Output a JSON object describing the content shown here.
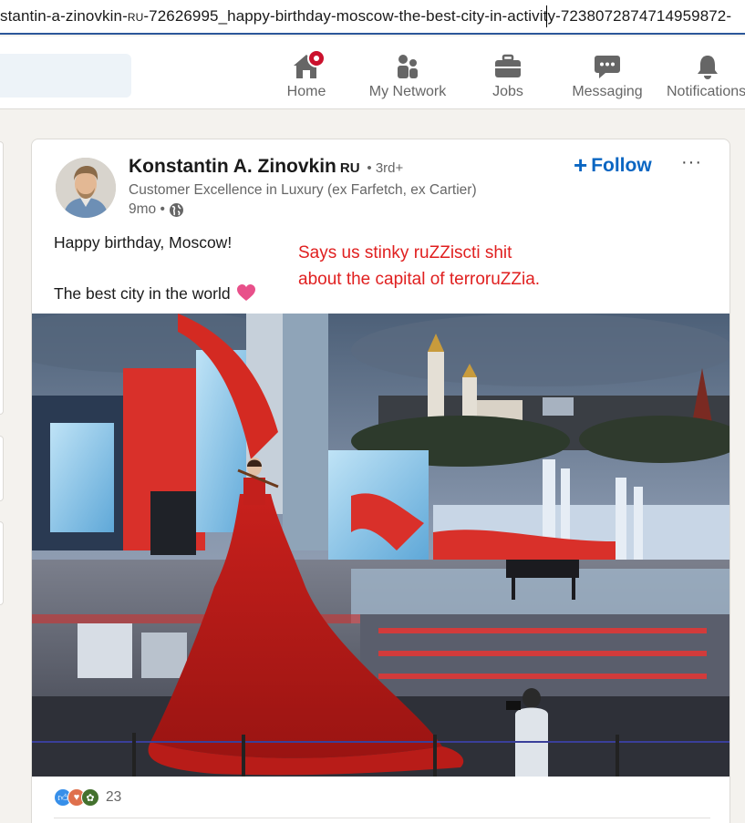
{
  "browser": {
    "url_prefix": "stantin-a-zinovkin-",
    "url_ru": "RU",
    "url_suffix": "-72626995_happy-birthday-moscow-the-best-city-in-activity-7238072874714959872-"
  },
  "nav": {
    "items": [
      {
        "label": "Home",
        "icon": "home-icon"
      },
      {
        "label": "My Network",
        "icon": "network-icon"
      },
      {
        "label": "Jobs",
        "icon": "jobs-icon"
      },
      {
        "label": "Messaging",
        "icon": "messaging-icon"
      },
      {
        "label": "Notifications",
        "icon": "bell-icon"
      }
    ]
  },
  "post": {
    "author": "Konstantin A. Zinovkin",
    "author_tag": "RU",
    "degree": "• 3rd+",
    "headline": "Customer Excellence in Luxury (ex Farfetch, ex Cartier)",
    "time": "9mo •",
    "follow_label": "Follow",
    "more_label": "···",
    "text_line1": "Happy birthday, Moscow!",
    "text_line2": "The best city in the world",
    "reaction_count": "23",
    "reaction_icons": [
      "like-icon",
      "love-icon",
      "support-icon"
    ]
  },
  "annotation": {
    "line1": "Says us stinky ruZZiscti shit",
    "line2": "about the capital of terroruZZia.",
    "color": "#e02020"
  },
  "colors": {
    "accent": "#0a66c2",
    "badge": "#cb112d"
  }
}
